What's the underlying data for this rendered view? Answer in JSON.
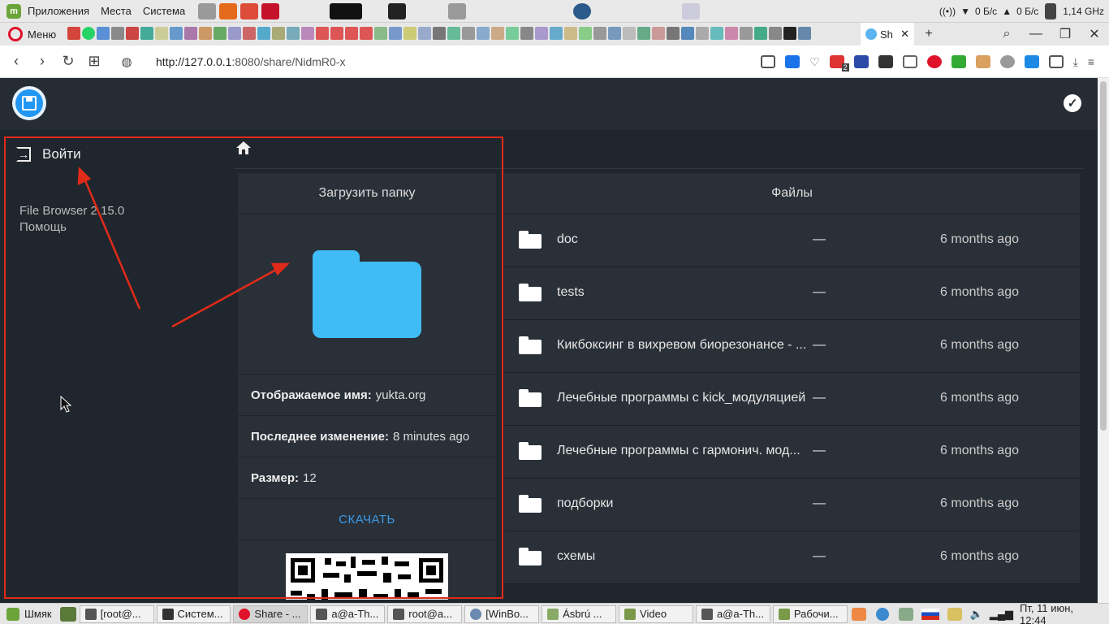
{
  "os_panel": {
    "menus": [
      "Приложения",
      "Места",
      "Система"
    ],
    "net_down": "0 Б/с",
    "net_up": "0 Б/с",
    "cpu_freq": "1,14 GHz"
  },
  "browser": {
    "menu_label": "Меню",
    "active_tab_label": "Sh",
    "url_host": "http://127.0.0.1",
    "url_path": ":8080/share/NidmR0-x",
    "extension_badge": "2"
  },
  "sidebar": {
    "login_label": "Войти",
    "version": "File Browser 2.15.0",
    "help": "Помощь"
  },
  "share": {
    "title": "Загрузить папку",
    "display_name_label": "Отображаемое имя:",
    "display_name_value": "yukta.org",
    "modified_label": "Последнее изменение:",
    "modified_value": "8 minutes ago",
    "size_label": "Размер:",
    "size_value": "12",
    "download_label": "СКАЧАТЬ"
  },
  "files": {
    "header": "Файлы",
    "rows": [
      {
        "name": "doc",
        "size": "—",
        "date": "6 months ago"
      },
      {
        "name": "tests",
        "size": "—",
        "date": "6 months ago"
      },
      {
        "name": "Кикбоксинг в вихревом биорезонансе - ...",
        "size": "—",
        "date": "6 months ago"
      },
      {
        "name": "Лечебные программы с kick_модуляцией",
        "size": "—",
        "date": "6 months ago"
      },
      {
        "name": "Лечебные программы с гармонич. мод...",
        "size": "—",
        "date": "6 months ago"
      },
      {
        "name": "подборки",
        "size": "—",
        "date": "6 months ago"
      },
      {
        "name": "схемы",
        "size": "—",
        "date": "6 months ago"
      }
    ]
  },
  "taskbar": {
    "start_label": "Шмяк",
    "tasks": [
      "[root@...",
      "Систем...",
      "Share - ...",
      "a@a-Th...",
      "root@a...",
      "[WinBo...",
      "Ásbrú ...",
      "Video",
      "a@a-Th...",
      "Рабочи..."
    ],
    "clock": "Пт, 11 июн, 12:44"
  },
  "colors": {
    "accent": "#2196f3",
    "folder": "#3fbcf5",
    "annotation": "#e02b1a",
    "link": "#3b9be8"
  }
}
